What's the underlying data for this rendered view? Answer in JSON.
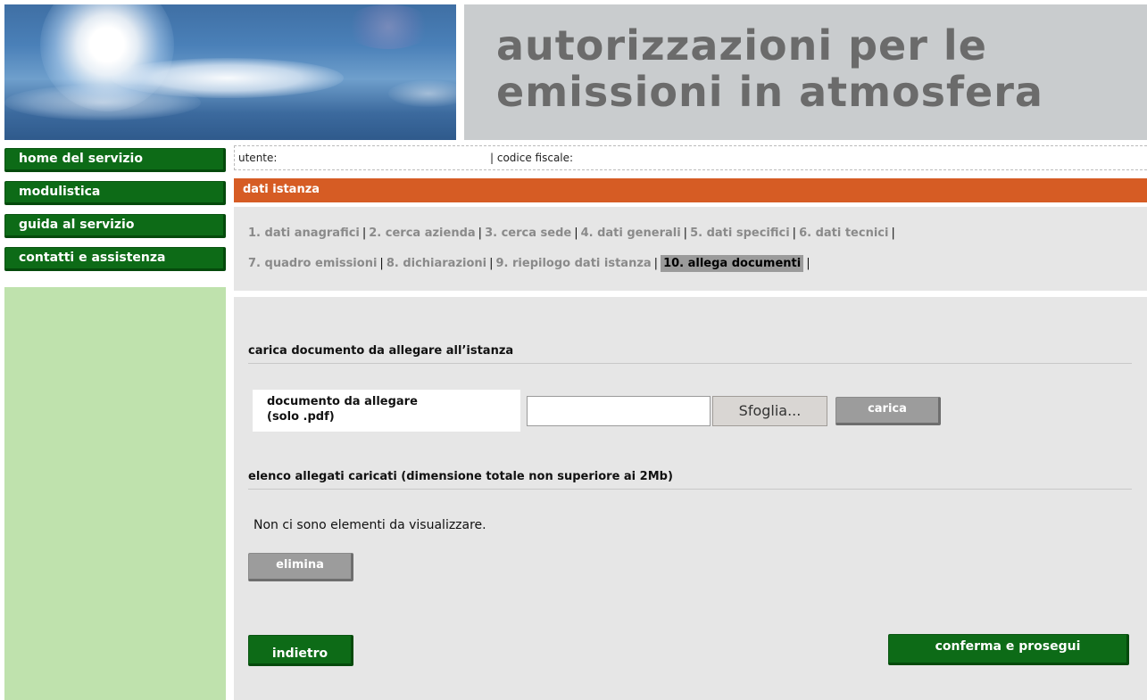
{
  "header": {
    "title_line1": "autorizzazioni per le",
    "title_line2": "emissioni in atmosfera"
  },
  "nav": {
    "items": [
      {
        "label": "home del servizio"
      },
      {
        "label": "modulistica"
      },
      {
        "label": "guida al servizio"
      },
      {
        "label": "contatti e assistenza"
      }
    ]
  },
  "userbar": {
    "user_label": "utente:",
    "fiscal_code_label": "| codice fiscale:"
  },
  "section_bar": {
    "title": "dati istanza"
  },
  "steps": [
    {
      "label": "1. dati anagrafici"
    },
    {
      "label": "2. cerca azienda"
    },
    {
      "label": "3. cerca sede"
    },
    {
      "label": "4. dati generali"
    },
    {
      "label": "5. dati specifici"
    },
    {
      "label": "6. dati tecnici"
    },
    {
      "label": "7. quadro emissioni"
    },
    {
      "label": "8. dichiarazioni"
    },
    {
      "label": "9. riepilogo dati istanza"
    },
    {
      "label": "10. allega documenti"
    }
  ],
  "active_step": "10. allega documenti",
  "upload": {
    "section_title": "carica documento da allegare all’istanza",
    "label_line1": "documento da allegare",
    "label_line2": "(solo .pdf)",
    "file_value": "",
    "browse_label": "Sfoglia...",
    "upload_button": "carica"
  },
  "attachments": {
    "section_title": "elenco allegati caricati (dimensione totale non superiore ai 2Mb)",
    "empty_message": "Non ci sono elementi da visualizzare.",
    "delete_button": "elimina"
  },
  "footer": {
    "back_button": "indietro",
    "confirm_button": "conferma e prosegui"
  },
  "colors": {
    "nav_green": "#0d6b17",
    "sidebar_green": "#bfe2ad",
    "accent_orange": "#d65c24",
    "panel_gray": "#e6e6e6",
    "title_text": "#6b6b6b"
  }
}
